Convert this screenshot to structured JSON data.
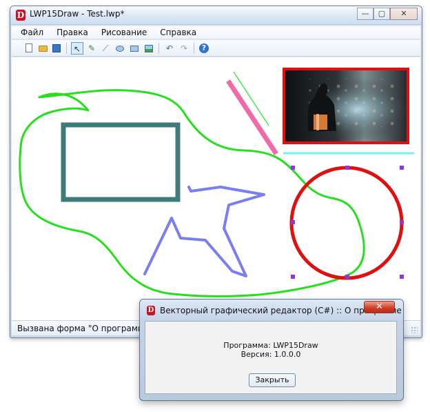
{
  "window": {
    "title": "LWP15Draw - Test.lwp*",
    "app_icon_letter": "D",
    "controls": {
      "minimize": "—",
      "maximize": "▢",
      "close": "✕"
    }
  },
  "menu": {
    "items": [
      "Файл",
      "Правка",
      "Рисование",
      "Справка"
    ]
  },
  "toolbar": {
    "icons": [
      "new-file-icon",
      "open-folder-icon",
      "save-icon",
      "pointer-icon",
      "pencil-icon",
      "line-icon",
      "ellipse-icon",
      "rectangle-icon",
      "image-icon",
      "undo-icon",
      "redo-icon",
      "help-icon"
    ],
    "selected_tool": "pointer-icon",
    "glyphs": {
      "pointer": "↖",
      "pencil": "✎",
      "line": "⟋",
      "undo": "↶",
      "redo": "↷",
      "help": "?"
    }
  },
  "statusbar": {
    "text": "Вызвана форма \"О программе\""
  },
  "dialog": {
    "title": "Векторный графический редактор (C#) :: О программе",
    "app_icon_letter": "D",
    "close_glyph": "✕",
    "program_line": "Программа: LWP15Draw",
    "version_line": "Версия: 1.0.0.0",
    "close_button_label": "Закрыть"
  },
  "colors": {
    "accent_red": "#e01010",
    "freehand_green": "#24e11b",
    "rectangle_teal": "#3f7b78",
    "polyline_blue": "#7b7df2",
    "pink_line": "#f06aa7",
    "thin_green_line": "#48e74b",
    "cyan_line": "#78f0f2",
    "handle_purple": "#8d3ad9"
  }
}
